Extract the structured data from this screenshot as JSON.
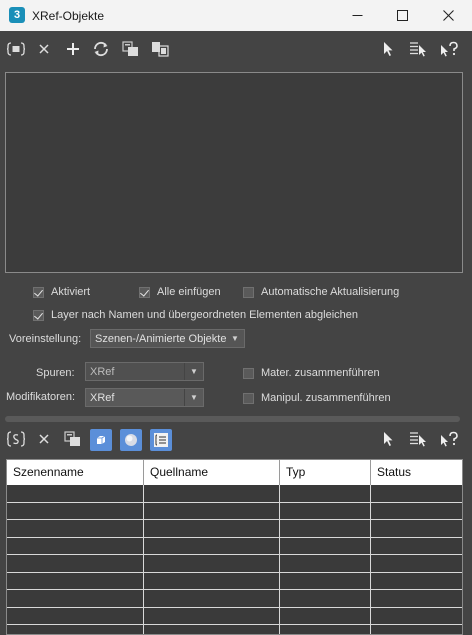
{
  "window": {
    "icon_text": "3",
    "title": "XRef-Objekte"
  },
  "top_toolbar": {
    "icons": [
      "scene-xref-icon",
      "delete-icon",
      "add-icon",
      "refresh-icon",
      "merge-icon",
      "convert-icon",
      "select-icon",
      "select-by-name-icon",
      "help-icon"
    ]
  },
  "options": {
    "aktiviert": {
      "label": "Aktiviert",
      "checked": true
    },
    "alle_einfuegen": {
      "label": "Alle einfügen",
      "checked": true
    },
    "auto_update": {
      "label": "Automatische Aktualisierung",
      "checked": false
    },
    "layer_match": {
      "label": "Layer nach Namen und übergeordneten Elementen abgleichen",
      "checked": true
    }
  },
  "preset": {
    "label": "Voreinstellung:",
    "value": "Szenen-/Animierte Objekte"
  },
  "tracks": {
    "label": "Spuren:",
    "value": "XRef"
  },
  "modifiers": {
    "label": "Modifikatoren:",
    "value": "XRef"
  },
  "merge_options": {
    "materials": {
      "label": "Mater. zusammenführen",
      "checked": false
    },
    "manipulators": {
      "label": "Manipul. zusammenführen",
      "checked": false
    }
  },
  "bottom_toolbar": {
    "icons": [
      "xref-record-icon",
      "delete-icon",
      "merge-icon",
      "box-icon",
      "sphere-icon",
      "list-icon",
      "select-icon",
      "select-by-name-icon",
      "help-icon"
    ]
  },
  "table": {
    "columns": [
      "Szenenname",
      "Quellname",
      "Typ",
      "Status"
    ],
    "empty_row_count": 9
  },
  "colors": {
    "panel": "#444444",
    "accent": "#5b8fd9",
    "titlebar": "#f3f3f3"
  }
}
